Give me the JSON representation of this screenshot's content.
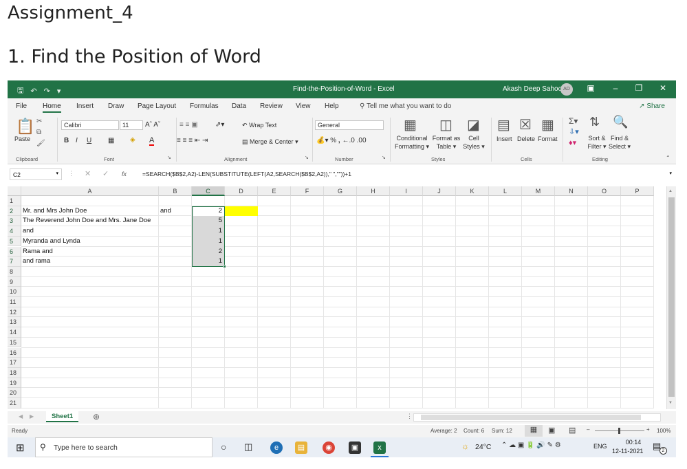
{
  "document": {
    "title": "Assignment_4",
    "heading": "1. Find the Position of Word"
  },
  "window": {
    "title": "Find-the-Position-of-Word  -  Excel",
    "user": "Akash Deep Sahoo",
    "user_initials": "AD",
    "accent": "#217346"
  },
  "tabs": [
    "File",
    "Home",
    "Insert",
    "Draw",
    "Page Layout",
    "Formulas",
    "Data",
    "Review",
    "View",
    "Help"
  ],
  "tell_me": "Tell me what you want to do",
  "share": "Share",
  "ribbon": {
    "paste": "Paste",
    "font_name": "Calibri",
    "font_size": "11",
    "wrap_text": "Wrap Text",
    "merge_center": "Merge & Center",
    "number_format": "General",
    "conditional_1": "Conditional",
    "conditional_2": "Formatting",
    "format_as_1": "Format as",
    "format_as_2": "Table",
    "cell_1": "Cell",
    "cell_2": "Styles",
    "insert": "Insert",
    "delete": "Delete",
    "format": "Format",
    "sort_1": "Sort &",
    "sort_2": "Filter",
    "find_1": "Find &",
    "find_2": "Select",
    "groups": {
      "clipboard": "Clipboard",
      "font": "Font",
      "alignment": "Alignment",
      "number": "Number",
      "styles": "Styles",
      "cells": "Cells",
      "editing": "Editing"
    }
  },
  "formula_bar": {
    "name_box": "C2",
    "fx": "fx",
    "formula": "=SEARCH($B$2,A2)-LEN(SUBSTITUTE(LEFT(A2,SEARCH($B$2,A2)),\" \",\"\"))+1"
  },
  "columns": [
    "A",
    "B",
    "C",
    "D",
    "E",
    "F",
    "G",
    "H",
    "I",
    "J",
    "K",
    "L",
    "M",
    "N",
    "O",
    "P"
  ],
  "rows": [
    "1",
    "2",
    "3",
    "4",
    "5",
    "6",
    "7",
    "8",
    "9",
    "10",
    "11",
    "12",
    "13",
    "14",
    "15",
    "16",
    "17",
    "18",
    "19",
    "20",
    "21"
  ],
  "cells": {
    "A2": "Mr. and Mrs John Doe",
    "A3": "The Reverend John Doe and Mrs. Jane Doe",
    "A4": "and",
    "A5": "Myranda and Lynda",
    "A6": "Rama and",
    "A7": "and rama",
    "B2": "and",
    "C2": "2",
    "C3": "5",
    "C4": "1",
    "C5": "1",
    "C6": "2",
    "C7": "1"
  },
  "highlight_color": "#ffff00",
  "sheet_tab": "Sheet1",
  "status": {
    "ready": "Ready",
    "average": "Average: 2",
    "count": "Count: 6",
    "sum": "Sum: 12",
    "zoom": "100%"
  },
  "taskbar": {
    "search_placeholder": "Type here to search",
    "weather": "24°C",
    "language": "ENG",
    "time": "00:14",
    "date": "12-11-2021",
    "notifications": "2"
  }
}
